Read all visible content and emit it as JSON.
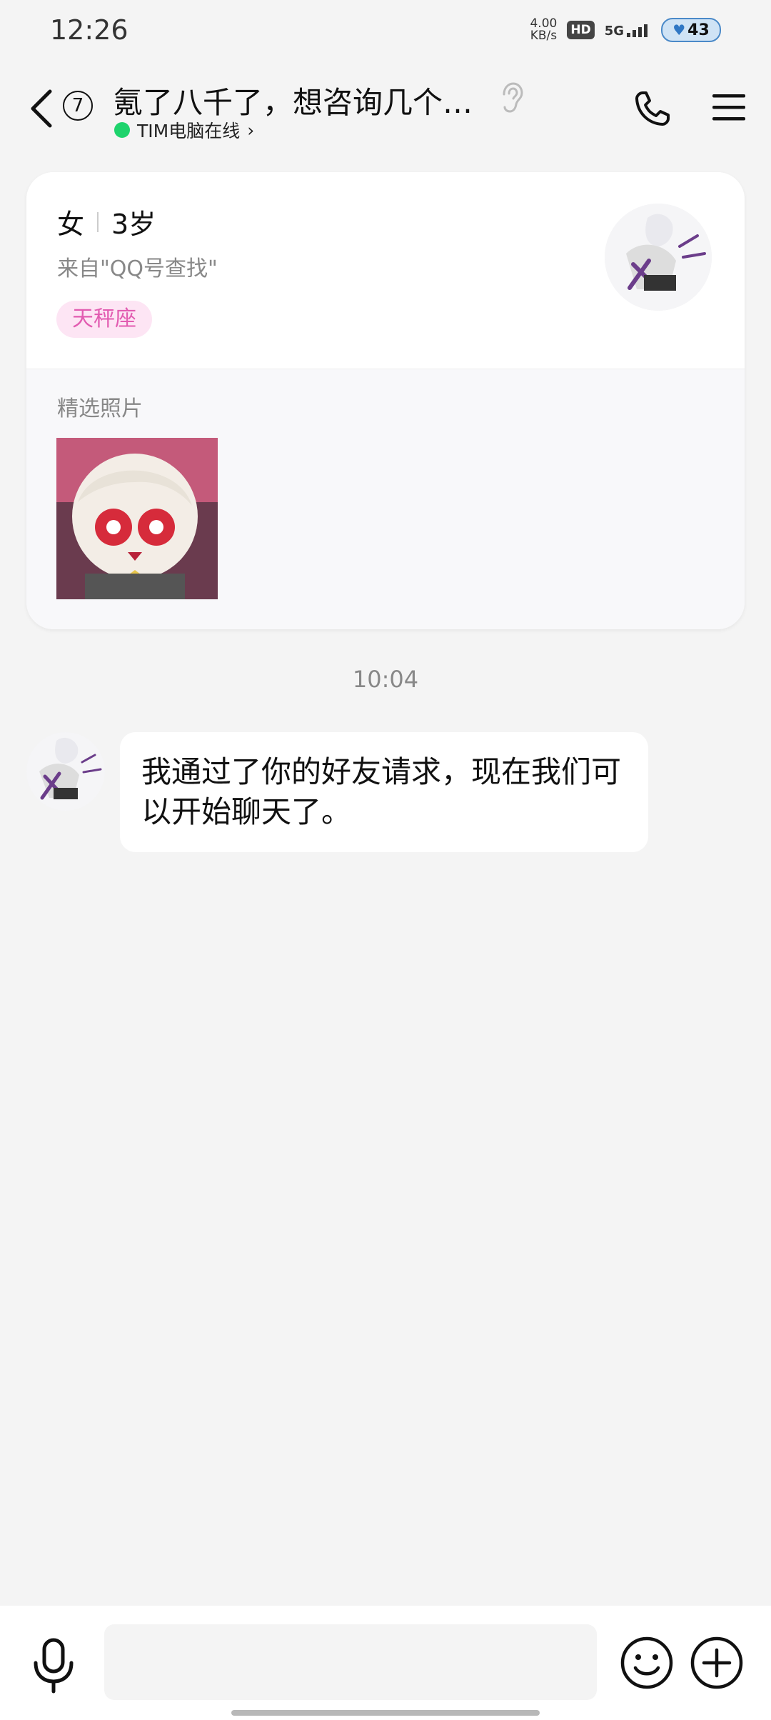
{
  "status_bar": {
    "time": "12:26",
    "net_speed_value": "4.00",
    "net_speed_unit": "KB/s",
    "hd": "HD",
    "network": "5G",
    "battery": "43",
    "icons": [
      "hd-icon",
      "signal-icon",
      "battery-icon"
    ]
  },
  "header": {
    "unread_count": "7",
    "title": "氪了八千了，想咨询几个…",
    "presence": "TIM电脑在线",
    "presence_chevron": "›",
    "icons": [
      "back-icon",
      "ear-icon",
      "phone-icon",
      "menu-icon"
    ],
    "presence_color": "#1ed36c"
  },
  "profile_card": {
    "gender": "女",
    "age": "3岁",
    "source": "来自\"QQ号查找\"",
    "zodiac": "天秤座",
    "photos_label": "精选照片",
    "zodiac_color": "#e25cb1"
  },
  "chat": {
    "time": "10:04",
    "messages": [
      {
        "text": "我通过了你的好友请求，现在我们可以开始聊天了。"
      }
    ]
  },
  "input_bar": {
    "placeholder": "",
    "icons": [
      "microphone-icon",
      "emoji-icon",
      "plus-icon"
    ]
  }
}
